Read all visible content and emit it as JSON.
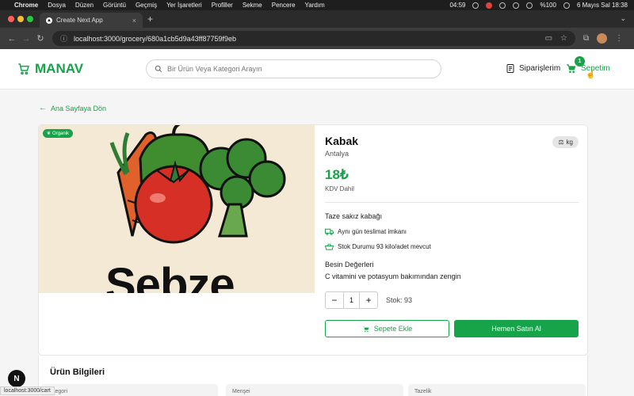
{
  "menubar": {
    "app": "Chrome",
    "items": [
      "Dosya",
      "Düzen",
      "Görüntü",
      "Geçmiş",
      "Yer İşaretleri",
      "Profiller",
      "Sekme",
      "Pencere",
      "Yardım"
    ],
    "timer": "04:59",
    "battery": "%100",
    "datetime": "6 Mayıs Sal  18:38"
  },
  "browser": {
    "tab_title": "Create Next App",
    "url": "localhost:3000/grocery/680a1cb5d9a43ff87759f9eb"
  },
  "header": {
    "logo": "MANAV",
    "search_placeholder": "Bir Ürün Veya Kategori Arayın",
    "orders_label": "Siparişlerim",
    "cart_label": "Sepetim",
    "cart_count": "1"
  },
  "back_link": "Ana Sayfaya Dön",
  "product": {
    "badge": "Organik",
    "image_text": "Sebze",
    "name": "Kabak",
    "origin": "Antalya",
    "unit": "kg",
    "price": "18₺",
    "tax_note": "KDV Dahil",
    "description": "Taze sakız kabağı",
    "delivery": "Aynı gün teslimat imkanı",
    "stock_status": "Stok Durumu 93 kilo/adet mevcut",
    "nutrition_title": "Besin Değerleri",
    "nutrition_value": "C vitamini ve potasyum bakımından zengin",
    "quantity": "1",
    "stock": "Stok: 93",
    "add_to_cart": "Sepete Ekle",
    "buy_now": "Hemen Satın Al"
  },
  "product_info": {
    "title": "Ürün Bilgileri",
    "boxes": [
      "Kategori",
      "Menşei",
      "Tazelik"
    ]
  },
  "status_url": "localhost:3000/cart",
  "dev_badge": "N",
  "colors": {
    "accent": "#16a34a",
    "image_bg": "#f4e9d5"
  }
}
